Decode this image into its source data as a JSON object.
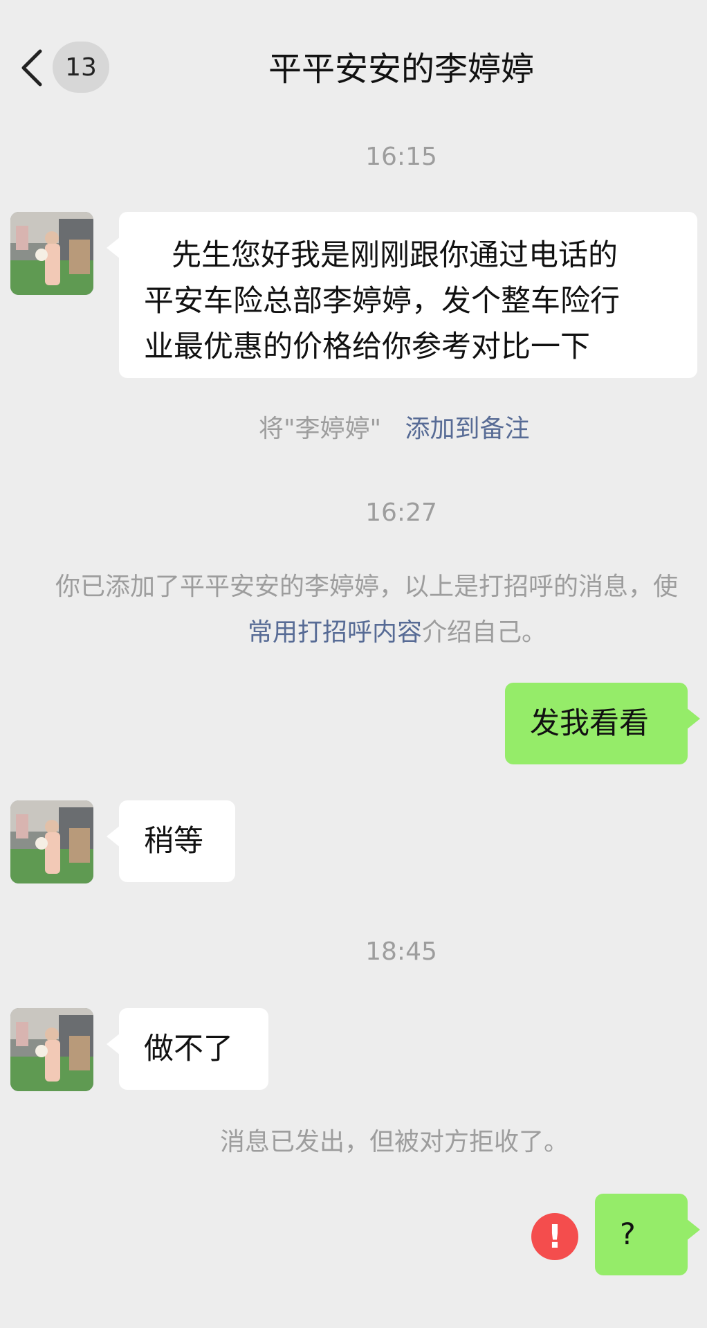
{
  "header": {
    "unread_count": "13",
    "title": "平平安安的李婷婷"
  },
  "timestamps": [
    "16:15",
    "16:27",
    "18:45"
  ],
  "messages": {
    "intro_line1": "先生您好我是刚刚跟你通过电话的",
    "intro_line2": "平安车险总部李婷婷，发个整车险行",
    "intro_line3": "业最优惠的价格给你参考对比一下",
    "send_me": "发我看看",
    "wait": "稍等",
    "cant_do": "做不了",
    "question": "?"
  },
  "system": {
    "remark_prefix": "将\"李婷婷\"",
    "remark_link": "添加到备注",
    "added_line1": "你已添加了平平安安的李婷婷，以上是打招呼的消息，使",
    "added_link": "常用打招呼内容",
    "added_suffix": "介绍自己。",
    "rejected": "消息已发出，但被对方拒收了。"
  },
  "colors": {
    "background": "#ededed",
    "bubble_self": "#95ec69",
    "bubble_other": "#ffffff",
    "link": "#576b95",
    "error": "#f44d4d"
  },
  "icons": {
    "back": "chevron-left-icon",
    "error": "exclamation-circle-icon"
  }
}
